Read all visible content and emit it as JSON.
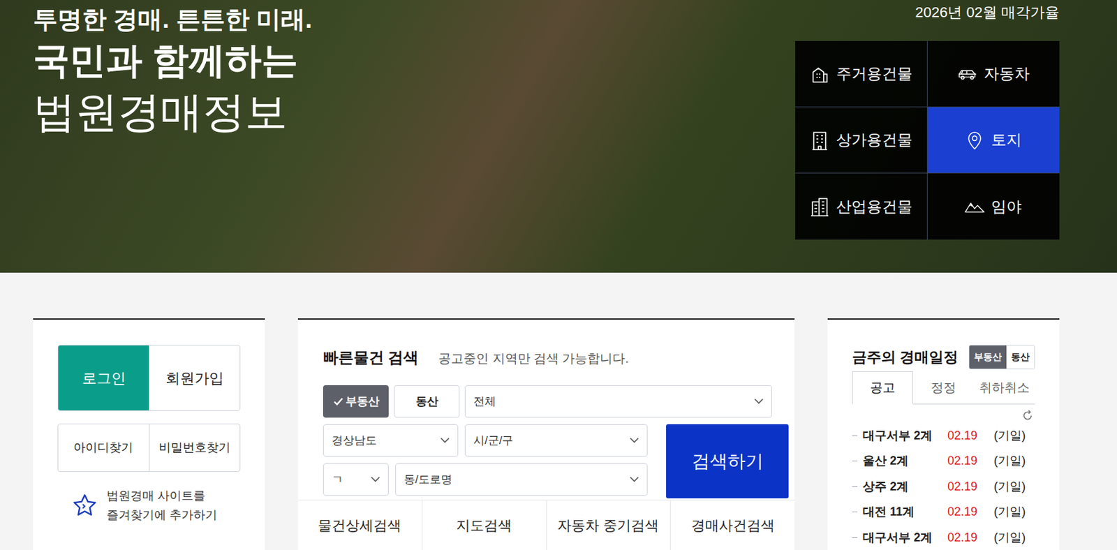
{
  "hero": {
    "slogan": "투명한 경매. 튼튼한 미래.",
    "headline": "국민과 함께하는",
    "title": "법원경매정보",
    "sale_rate_link": "2026년 02월 매각가율"
  },
  "categories": [
    {
      "label": "주거용건물",
      "selected": false
    },
    {
      "label": "자동차",
      "selected": false
    },
    {
      "label": "상가용건물",
      "selected": false
    },
    {
      "label": "토지",
      "selected": true
    },
    {
      "label": "산업용건물",
      "selected": false
    },
    {
      "label": "임야",
      "selected": false
    }
  ],
  "account": {
    "login": "로그인",
    "signup": "회원가입",
    "find_id": "아이디찾기",
    "find_password": "비밀번호찾기",
    "bookmark": "법원경매 사이트를\n즐겨찾기에 추가하기"
  },
  "quick_search": {
    "title": "빠른물건 검색",
    "note": "공고중인 지역만 검색 가능합니다.",
    "types": [
      {
        "label": "부동산",
        "selected": true
      },
      {
        "label": "동산",
        "selected": false
      }
    ],
    "usage": "전체",
    "province": "경상남도",
    "city": "시/군/구",
    "initial": "ㄱ",
    "dong": "동/도로명",
    "search_button": "검색하기",
    "links": [
      "물건상세검색",
      "지도검색",
      "자동차 중기검색",
      "경매사건검색"
    ]
  },
  "schedule": {
    "title": "금주의 경매일정",
    "kinds": [
      {
        "label": "부동산",
        "selected": true
      },
      {
        "label": "동산",
        "selected": false
      }
    ],
    "tabs": [
      {
        "label": "공고",
        "selected": true
      },
      {
        "label": "정정",
        "selected": false
      },
      {
        "label": "취하취소",
        "selected": false
      }
    ],
    "items": [
      {
        "court": "대구서부 2계",
        "date": "02.19",
        "note": "(기일)"
      },
      {
        "court": "울산 2계",
        "date": "02.19",
        "note": "(기일)"
      },
      {
        "court": "상주 2계",
        "date": "02.19",
        "note": "(기일)"
      },
      {
        "court": "대전 11계",
        "date": "02.19",
        "note": "(기일)"
      },
      {
        "court": "대구서부 2계",
        "date": "02.19",
        "note": "(기일)"
      }
    ]
  }
}
